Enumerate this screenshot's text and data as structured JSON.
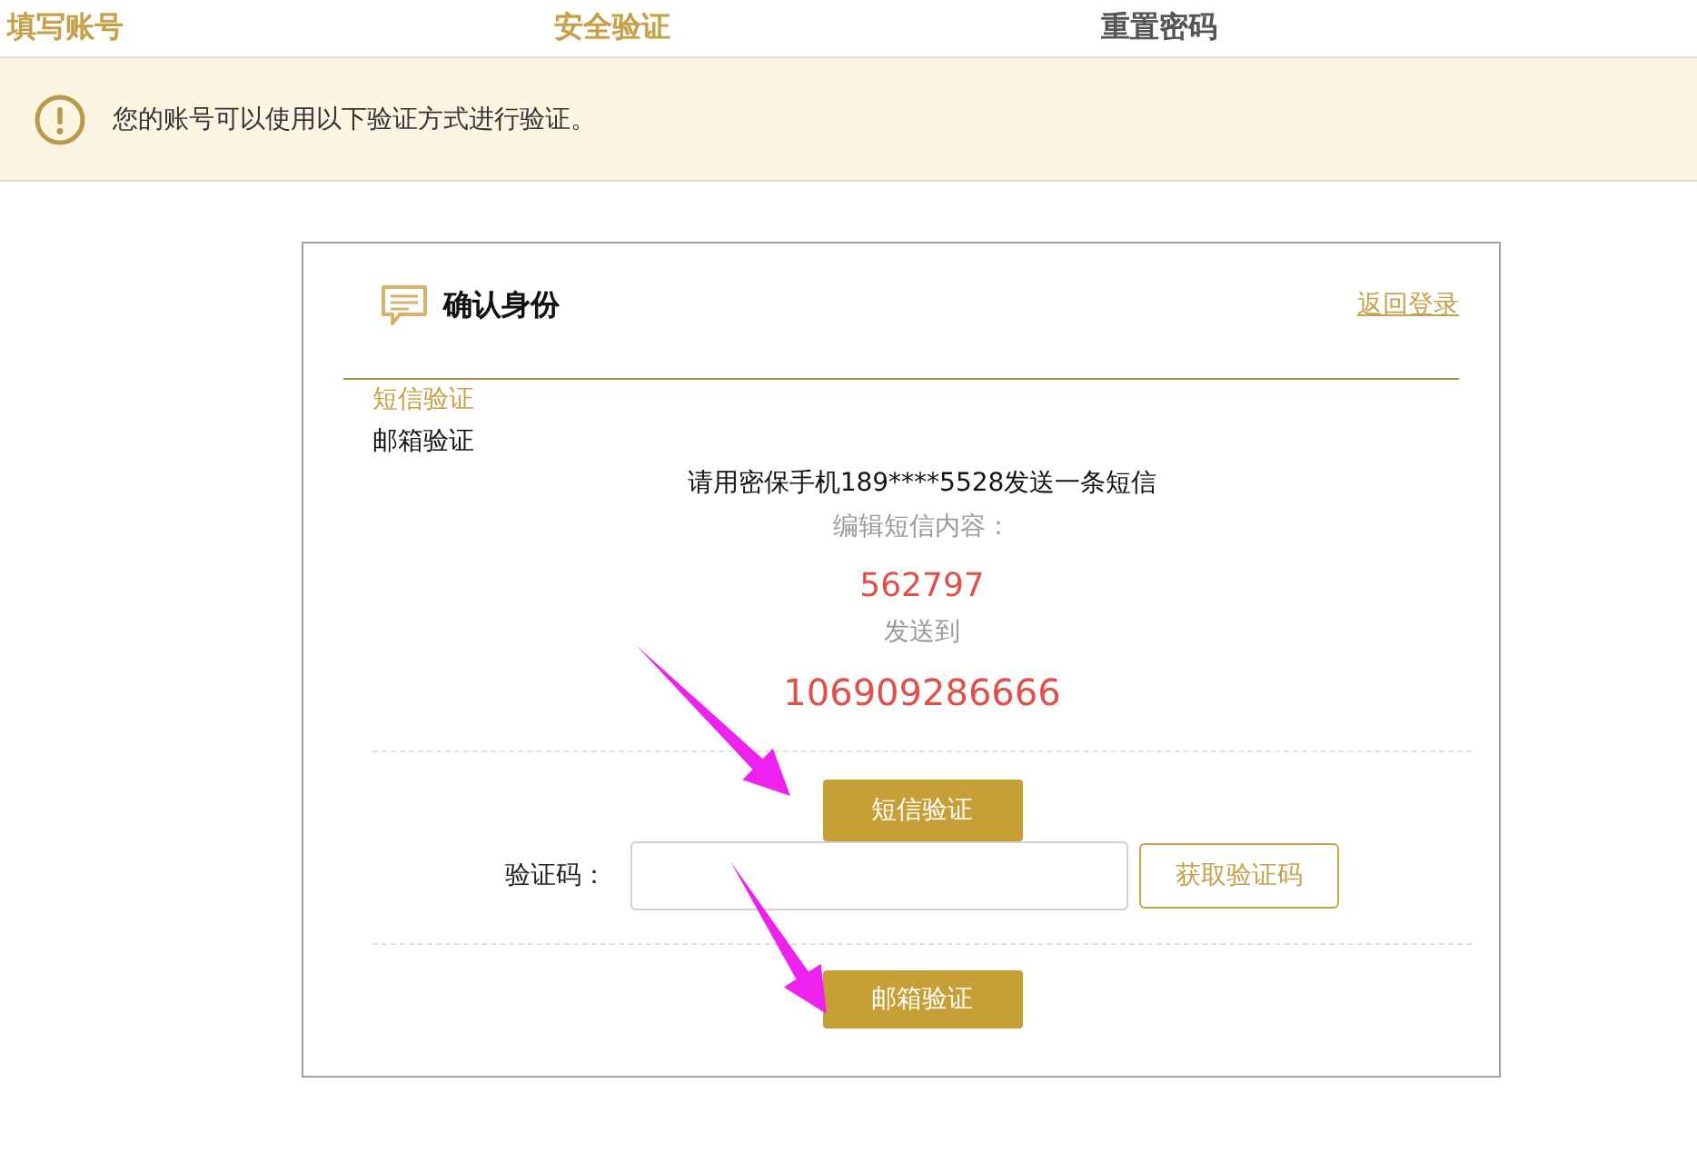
{
  "steps": [
    {
      "label": "填写账号",
      "reached": true
    },
    {
      "label": "安全验证",
      "reached": true
    },
    {
      "label": "重置密码",
      "reached": false
    }
  ],
  "notice": {
    "text": "您的账号可以使用以下验证方式进行验证。"
  },
  "card": {
    "title": "确认身份",
    "back_link": "返回登录",
    "methods": [
      {
        "label": "短信验证",
        "selected": true
      },
      {
        "label": "邮箱验证",
        "selected": false
      }
    ],
    "sms": {
      "instruction": "请用密保手机189****5528发送一条短信",
      "content_label": "编辑短信内容：",
      "content": "562797",
      "send_to_label": "发送到",
      "send_to": "106909286666",
      "button": "短信验证"
    },
    "code_row": {
      "label": "验证码：",
      "get_code_button": "获取验证码"
    },
    "email_button": "邮箱验证"
  }
}
